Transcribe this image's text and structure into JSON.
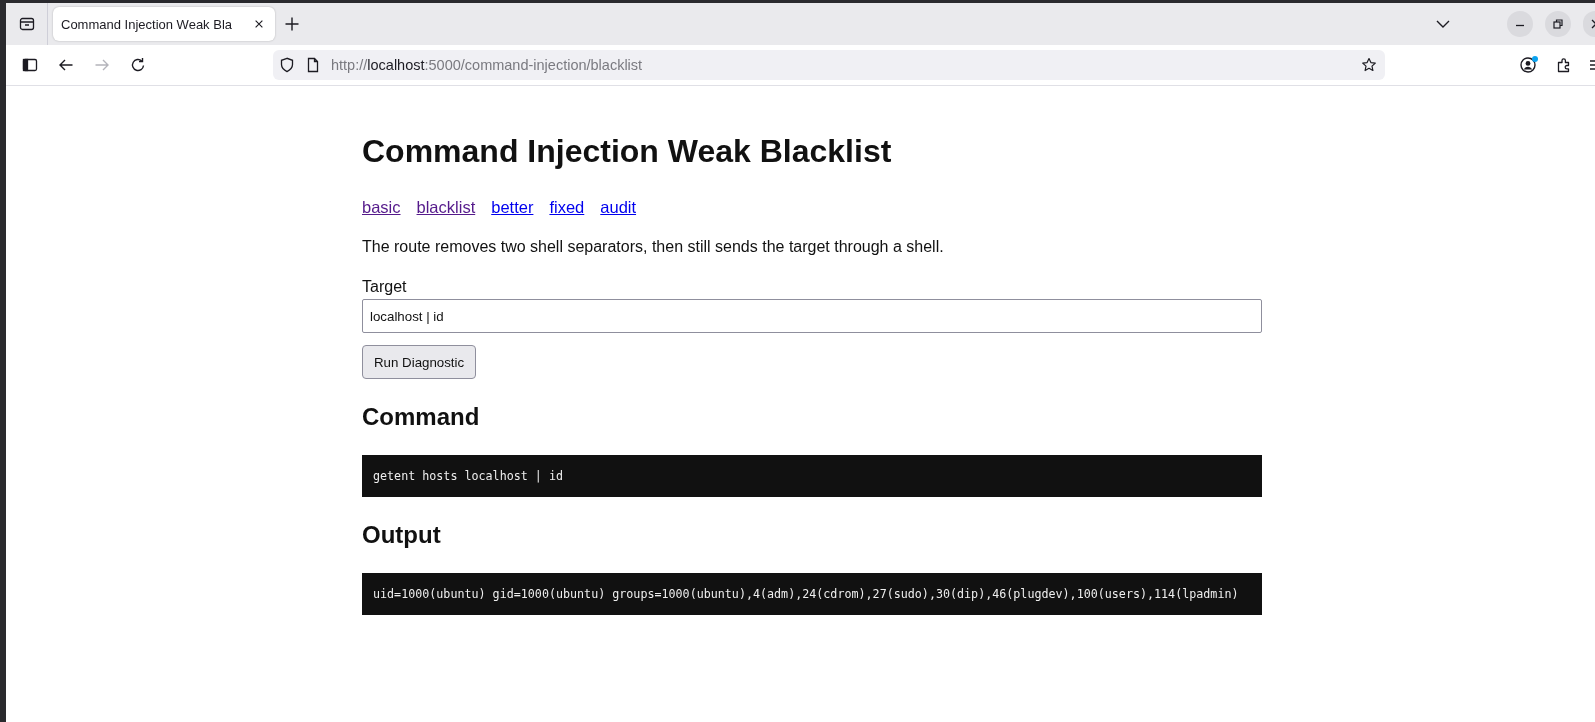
{
  "browser": {
    "tabs": [
      {
        "title": "Command Injection Weak Bla",
        "selected": true
      }
    ],
    "navigation": {
      "back": {
        "disabled": false
      },
      "forward": {
        "disabled": true
      }
    },
    "address": {
      "prefix": "http://",
      "host": "localhost",
      "suffix": ":5000/command-injection/blacklist"
    },
    "account": {
      "has_notification": true
    }
  },
  "page": {
    "title": "Command Injection Weak Blacklist",
    "links": [
      {
        "label": "basic",
        "visited": true
      },
      {
        "label": "blacklist",
        "visited": true
      },
      {
        "label": "better",
        "visited": false
      },
      {
        "label": "fixed",
        "visited": false
      },
      {
        "label": "audit",
        "visited": false
      }
    ],
    "description": "The route removes two shell separators, then still sends the target through a shell.",
    "form": {
      "label": "Target",
      "value": "localhost | id",
      "button": "Run Diagnostic"
    },
    "sections": [
      {
        "heading": "Command",
        "code": "getent hosts localhost | id"
      },
      {
        "heading": "Output",
        "code": "uid=1000(ubuntu) gid=1000(ubuntu) groups=1000(ubuntu),4(adm),24(cdrom),27(sudo),30(dip),46(plugdev),100(users),114(lpadmin)"
      }
    ]
  }
}
